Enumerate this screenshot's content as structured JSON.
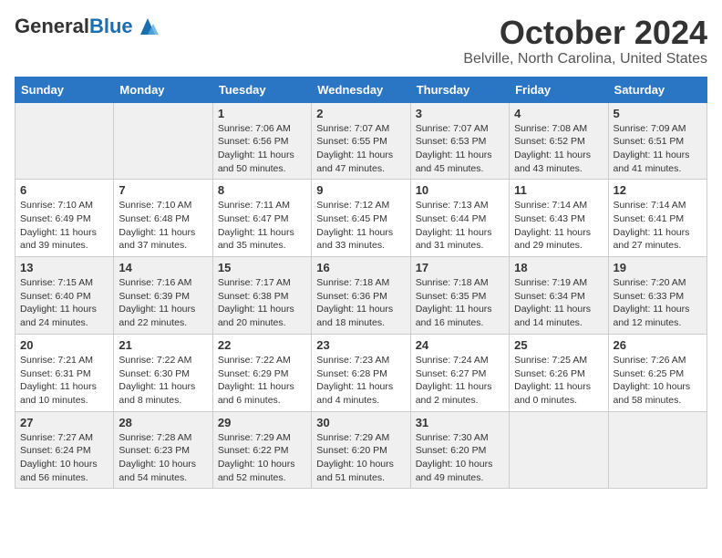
{
  "header": {
    "logo_general": "General",
    "logo_blue": "Blue",
    "month": "October 2024",
    "location": "Belville, North Carolina, United States"
  },
  "calendar": {
    "weekdays": [
      "Sunday",
      "Monday",
      "Tuesday",
      "Wednesday",
      "Thursday",
      "Friday",
      "Saturday"
    ],
    "rows": [
      [
        {
          "day": "",
          "info": ""
        },
        {
          "day": "",
          "info": ""
        },
        {
          "day": "1",
          "info": "Sunrise: 7:06 AM\nSunset: 6:56 PM\nDaylight: 11 hours and 50 minutes."
        },
        {
          "day": "2",
          "info": "Sunrise: 7:07 AM\nSunset: 6:55 PM\nDaylight: 11 hours and 47 minutes."
        },
        {
          "day": "3",
          "info": "Sunrise: 7:07 AM\nSunset: 6:53 PM\nDaylight: 11 hours and 45 minutes."
        },
        {
          "day": "4",
          "info": "Sunrise: 7:08 AM\nSunset: 6:52 PM\nDaylight: 11 hours and 43 minutes."
        },
        {
          "day": "5",
          "info": "Sunrise: 7:09 AM\nSunset: 6:51 PM\nDaylight: 11 hours and 41 minutes."
        }
      ],
      [
        {
          "day": "6",
          "info": "Sunrise: 7:10 AM\nSunset: 6:49 PM\nDaylight: 11 hours and 39 minutes."
        },
        {
          "day": "7",
          "info": "Sunrise: 7:10 AM\nSunset: 6:48 PM\nDaylight: 11 hours and 37 minutes."
        },
        {
          "day": "8",
          "info": "Sunrise: 7:11 AM\nSunset: 6:47 PM\nDaylight: 11 hours and 35 minutes."
        },
        {
          "day": "9",
          "info": "Sunrise: 7:12 AM\nSunset: 6:45 PM\nDaylight: 11 hours and 33 minutes."
        },
        {
          "day": "10",
          "info": "Sunrise: 7:13 AM\nSunset: 6:44 PM\nDaylight: 11 hours and 31 minutes."
        },
        {
          "day": "11",
          "info": "Sunrise: 7:14 AM\nSunset: 6:43 PM\nDaylight: 11 hours and 29 minutes."
        },
        {
          "day": "12",
          "info": "Sunrise: 7:14 AM\nSunset: 6:41 PM\nDaylight: 11 hours and 27 minutes."
        }
      ],
      [
        {
          "day": "13",
          "info": "Sunrise: 7:15 AM\nSunset: 6:40 PM\nDaylight: 11 hours and 24 minutes."
        },
        {
          "day": "14",
          "info": "Sunrise: 7:16 AM\nSunset: 6:39 PM\nDaylight: 11 hours and 22 minutes."
        },
        {
          "day": "15",
          "info": "Sunrise: 7:17 AM\nSunset: 6:38 PM\nDaylight: 11 hours and 20 minutes."
        },
        {
          "day": "16",
          "info": "Sunrise: 7:18 AM\nSunset: 6:36 PM\nDaylight: 11 hours and 18 minutes."
        },
        {
          "day": "17",
          "info": "Sunrise: 7:18 AM\nSunset: 6:35 PM\nDaylight: 11 hours and 16 minutes."
        },
        {
          "day": "18",
          "info": "Sunrise: 7:19 AM\nSunset: 6:34 PM\nDaylight: 11 hours and 14 minutes."
        },
        {
          "day": "19",
          "info": "Sunrise: 7:20 AM\nSunset: 6:33 PM\nDaylight: 11 hours and 12 minutes."
        }
      ],
      [
        {
          "day": "20",
          "info": "Sunrise: 7:21 AM\nSunset: 6:31 PM\nDaylight: 11 hours and 10 minutes."
        },
        {
          "day": "21",
          "info": "Sunrise: 7:22 AM\nSunset: 6:30 PM\nDaylight: 11 hours and 8 minutes."
        },
        {
          "day": "22",
          "info": "Sunrise: 7:22 AM\nSunset: 6:29 PM\nDaylight: 11 hours and 6 minutes."
        },
        {
          "day": "23",
          "info": "Sunrise: 7:23 AM\nSunset: 6:28 PM\nDaylight: 11 hours and 4 minutes."
        },
        {
          "day": "24",
          "info": "Sunrise: 7:24 AM\nSunset: 6:27 PM\nDaylight: 11 hours and 2 minutes."
        },
        {
          "day": "25",
          "info": "Sunrise: 7:25 AM\nSunset: 6:26 PM\nDaylight: 11 hours and 0 minutes."
        },
        {
          "day": "26",
          "info": "Sunrise: 7:26 AM\nSunset: 6:25 PM\nDaylight: 10 hours and 58 minutes."
        }
      ],
      [
        {
          "day": "27",
          "info": "Sunrise: 7:27 AM\nSunset: 6:24 PM\nDaylight: 10 hours and 56 minutes."
        },
        {
          "day": "28",
          "info": "Sunrise: 7:28 AM\nSunset: 6:23 PM\nDaylight: 10 hours and 54 minutes."
        },
        {
          "day": "29",
          "info": "Sunrise: 7:29 AM\nSunset: 6:22 PM\nDaylight: 10 hours and 52 minutes."
        },
        {
          "day": "30",
          "info": "Sunrise: 7:29 AM\nSunset: 6:20 PM\nDaylight: 10 hours and 51 minutes."
        },
        {
          "day": "31",
          "info": "Sunrise: 7:30 AM\nSunset: 6:20 PM\nDaylight: 10 hours and 49 minutes."
        },
        {
          "day": "",
          "info": ""
        },
        {
          "day": "",
          "info": ""
        }
      ]
    ]
  }
}
